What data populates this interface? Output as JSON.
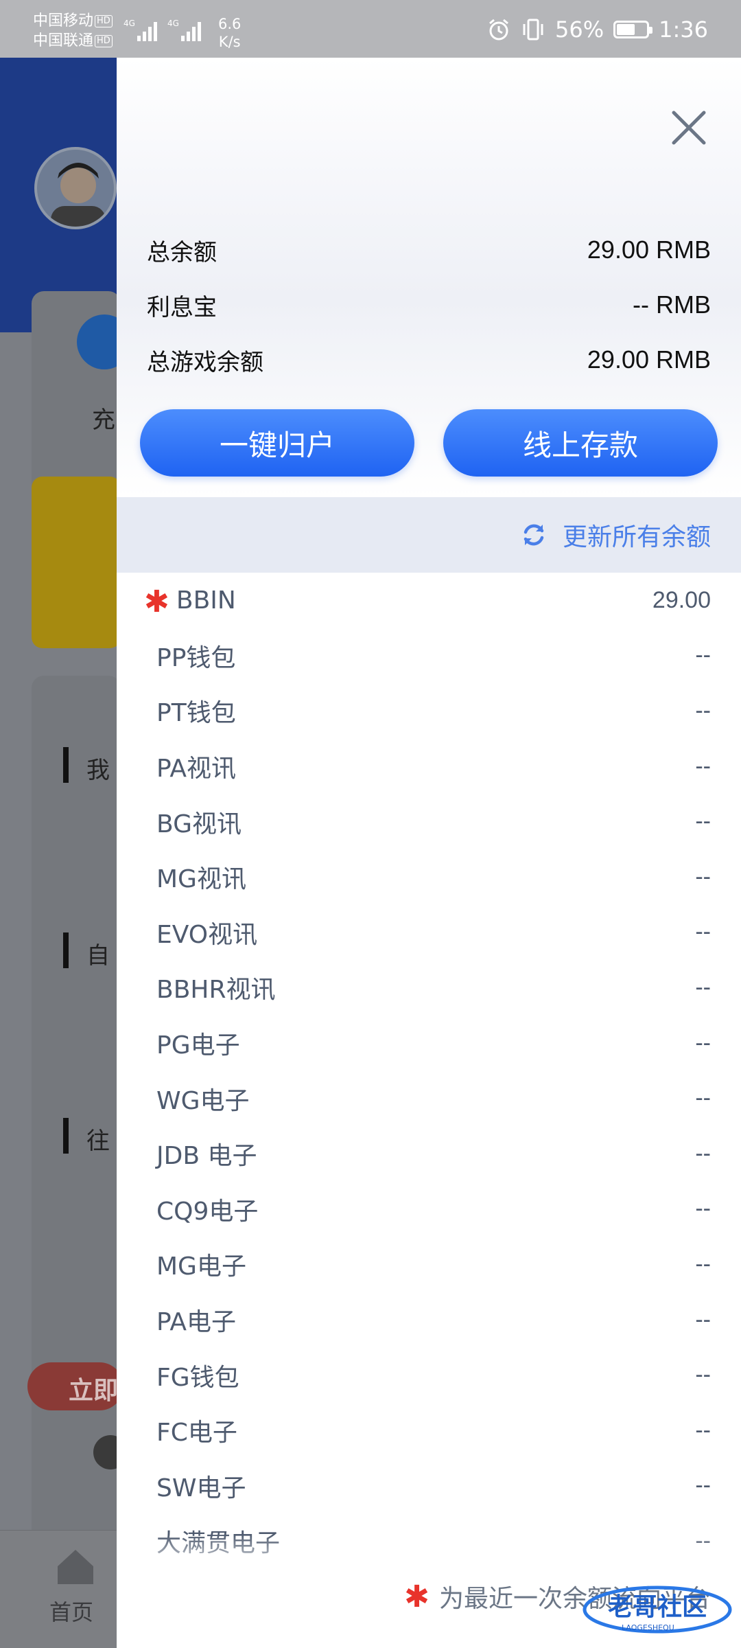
{
  "status_bar": {
    "carrier1": "中国移动",
    "carrier2": "中国联通",
    "hd": "HD",
    "net_type": "4G",
    "net_speed": "6.6",
    "net_unit": "K/s",
    "battery": "56%",
    "time": "1:36"
  },
  "background": {
    "tab_home": "首页",
    "card_label": "充",
    "section1": "我",
    "section2": "自",
    "section3": "往",
    "red_button": "立即"
  },
  "summary": {
    "rows": [
      {
        "label": "总余额",
        "value": "29.00 RMB"
      },
      {
        "label": "利息宝",
        "value": "-- RMB"
      },
      {
        "label": "总游戏余额",
        "value": "29.00 RMB"
      }
    ]
  },
  "actions": {
    "collect_label": "一键归户",
    "deposit_label": "线上存款"
  },
  "refresh": {
    "label": "更新所有余额"
  },
  "wallets": [
    {
      "name": "BBIN",
      "value": "29.00",
      "starred": true
    },
    {
      "name": "PP钱包",
      "value": "--"
    },
    {
      "name": "PT钱包",
      "value": "--"
    },
    {
      "name": "PA视讯",
      "value": "--"
    },
    {
      "name": "BG视讯",
      "value": "--"
    },
    {
      "name": "MG视讯",
      "value": "--"
    },
    {
      "name": "EVO视讯",
      "value": "--"
    },
    {
      "name": "BBHR视讯",
      "value": "--"
    },
    {
      "name": "PG电子",
      "value": "--"
    },
    {
      "name": "WG电子",
      "value": "--"
    },
    {
      "name": "JDB 电子",
      "value": "--"
    },
    {
      "name": "CQ9电子",
      "value": "--"
    },
    {
      "name": "MG电子",
      "value": "--"
    },
    {
      "name": "PA电子",
      "value": "--"
    },
    {
      "name": "FG钱包",
      "value": "--"
    },
    {
      "name": "FC电子",
      "value": "--"
    },
    {
      "name": "SW电子",
      "value": "--"
    },
    {
      "name": "大满贯电子",
      "value": "--"
    }
  ],
  "footer": {
    "note": "为最近一次余额流向平台"
  },
  "watermark": {
    "text": "老哥社区",
    "sub": "LAOGESHEQU"
  },
  "colors": {
    "accent": "#2a6ff5",
    "star": "#e8332b",
    "refresh_bg": "#e6eaf3"
  }
}
